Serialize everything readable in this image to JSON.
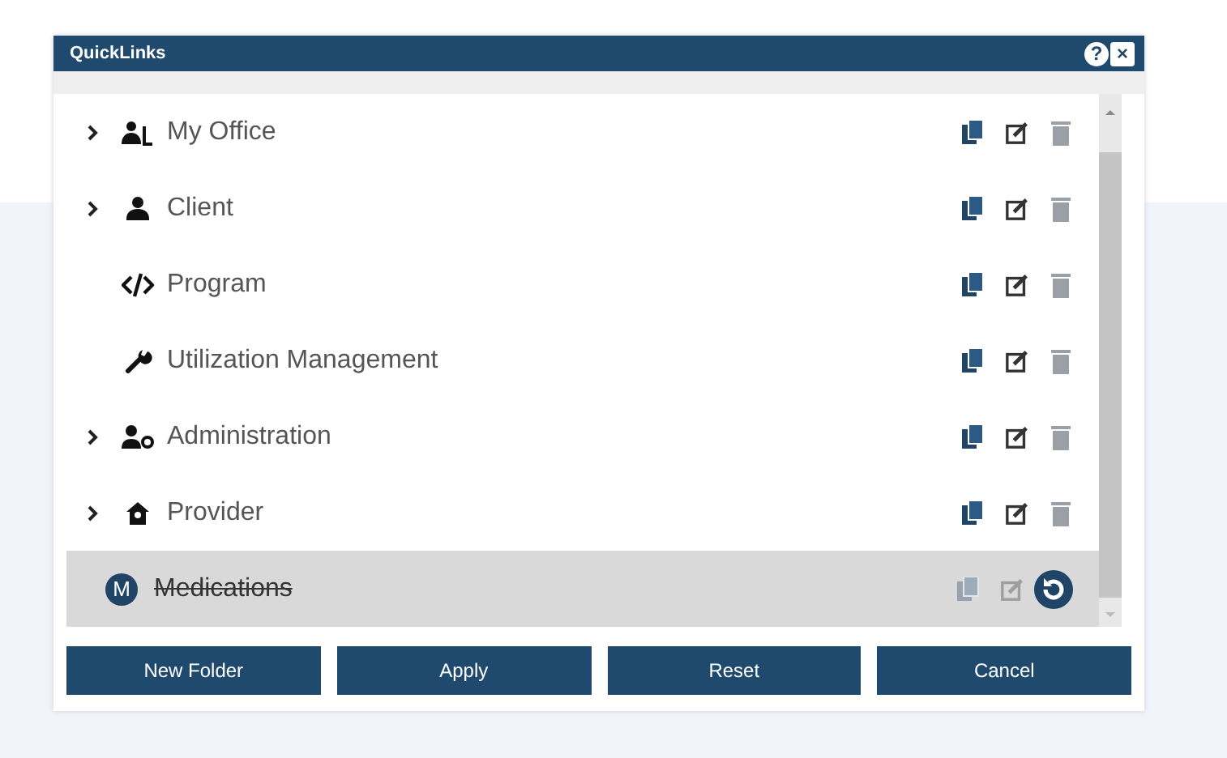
{
  "window": {
    "title": "QuickLinks",
    "help": "?",
    "close": "×"
  },
  "items": [
    {
      "label": "My Office",
      "kind": "office",
      "expandable": true,
      "deleted": false
    },
    {
      "label": "Client",
      "kind": "client",
      "expandable": true,
      "deleted": false
    },
    {
      "label": "Program",
      "kind": "program",
      "expandable": false,
      "deleted": false
    },
    {
      "label": "Utilization Management",
      "kind": "tool",
      "expandable": false,
      "deleted": false
    },
    {
      "label": "Administration",
      "kind": "admin",
      "expandable": true,
      "deleted": false
    },
    {
      "label": "Provider",
      "kind": "provider",
      "expandable": true,
      "deleted": false
    },
    {
      "label": "Medications",
      "kind": "badge",
      "badge": "M",
      "expandable": false,
      "deleted": true
    }
  ],
  "buttons": [
    "New Folder",
    "Apply",
    "Reset",
    "Cancel"
  ]
}
